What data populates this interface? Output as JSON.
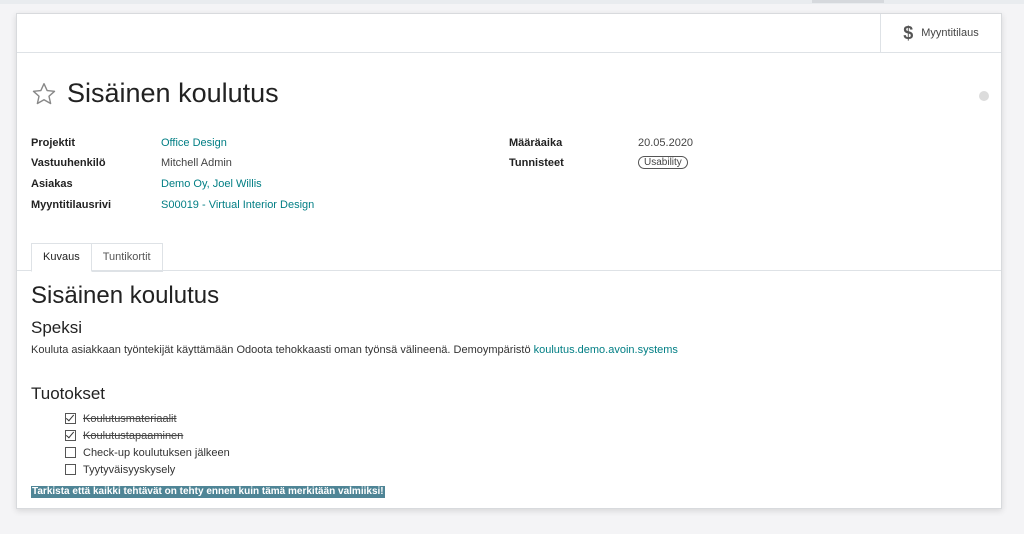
{
  "smart_button": {
    "label": "Myyntitilaus",
    "icon": "dollar-icon"
  },
  "title": "Sisäinen koulutus",
  "fields_left": [
    {
      "label": "Projektit",
      "value": "Office Design"
    },
    {
      "label": "Vastuuhenkilö",
      "value": "Mitchell Admin"
    },
    {
      "label": "Asiakas",
      "value": "Demo Oy, Joel Willis"
    },
    {
      "label": "Myyntitilausrivi",
      "value": "S00019 - Virtual Interior Design"
    }
  ],
  "fields_right": [
    {
      "label": "Määräaika",
      "value": "20.05.2020"
    },
    {
      "label": "Tunnisteet",
      "value": "Usability"
    }
  ],
  "tabs": [
    {
      "label": "Kuvaus"
    },
    {
      "label": "Tuntikortit"
    }
  ],
  "description": {
    "heading": "Sisäinen koulutus",
    "subheading": "Speksi",
    "paragraph": "Kouluta asiakkaan työntekijät käyttämään Odoota tehokkaasti oman työnsä välineenä. Demoympäristö",
    "link": "koulutus.demo.avoin.systems",
    "deliverables_heading": "Tuotokset",
    "checklist": [
      {
        "label": "Koulutusmateriaalit",
        "checked": true
      },
      {
        "label": "Koulutustapaaminen",
        "checked": true
      },
      {
        "label": "Check-up koulutuksen jälkeen",
        "checked": false
      },
      {
        "label": "Tyytyväisyyskysely",
        "checked": false
      }
    ],
    "note": "Tarkista että kaikki tehtävät on tehty ennen kuin tämä merkitään valmiiksi!"
  },
  "colors": {
    "link": "#017e84",
    "highlight": "#4f8596"
  }
}
